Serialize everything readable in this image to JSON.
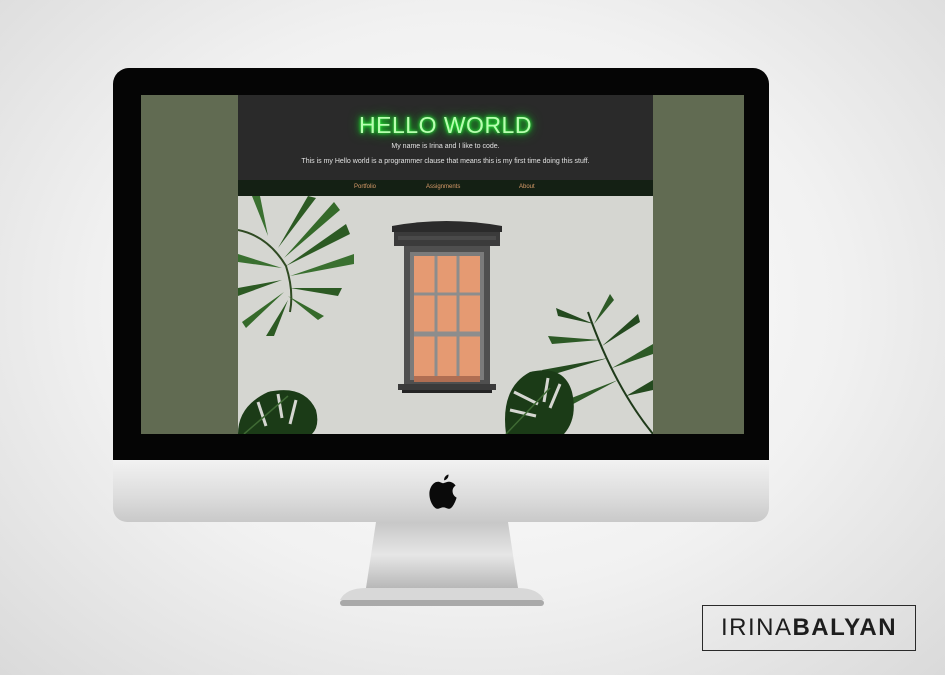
{
  "website": {
    "title": "HELLO WORLD",
    "intro_line": "My name is Irina and I like to code.",
    "description_line": "This is my Hello world is a programmer clause that means this is my first time doing this stuff.",
    "nav": [
      {
        "label": "Portfolio"
      },
      {
        "label": "Assignments"
      },
      {
        "label": "About"
      }
    ],
    "colors": {
      "side_panels": "#616b52",
      "header_bg": "#2a2a2a",
      "nav_bg": "#142014",
      "nav_text": "#d99c6a",
      "title_neon": "#2aff3a",
      "hero_wall": "#d5d6d1",
      "window_glass": "#e59a72"
    }
  },
  "device": {
    "type": "imac",
    "logo_icon": "apple-icon"
  },
  "signature": {
    "first": "IRINA",
    "last": "BALYAN"
  }
}
